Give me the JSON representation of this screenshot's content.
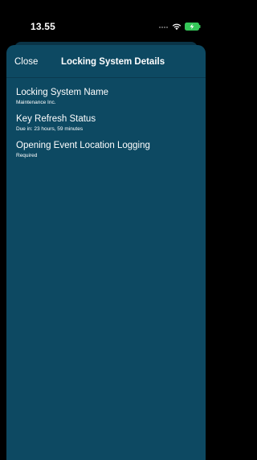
{
  "status_bar": {
    "time": "13.55"
  },
  "nav": {
    "close_label": "Close",
    "title": "Locking System Details"
  },
  "details": [
    {
      "title": "Locking System Name",
      "subtitle": "Maintenance Inc."
    },
    {
      "title": "Key Refresh Status",
      "subtitle": "Due in: 23 hours, 59 minutes"
    },
    {
      "title": "Opening Event Location Logging",
      "subtitle": "Required"
    }
  ],
  "colors": {
    "background": "#000000",
    "sheet": "#0d4962",
    "battery_fill": "#35c759",
    "text": "#ffffff"
  },
  "icons": [
    "signal-icon",
    "wifi-icon",
    "battery-charging-icon"
  ]
}
